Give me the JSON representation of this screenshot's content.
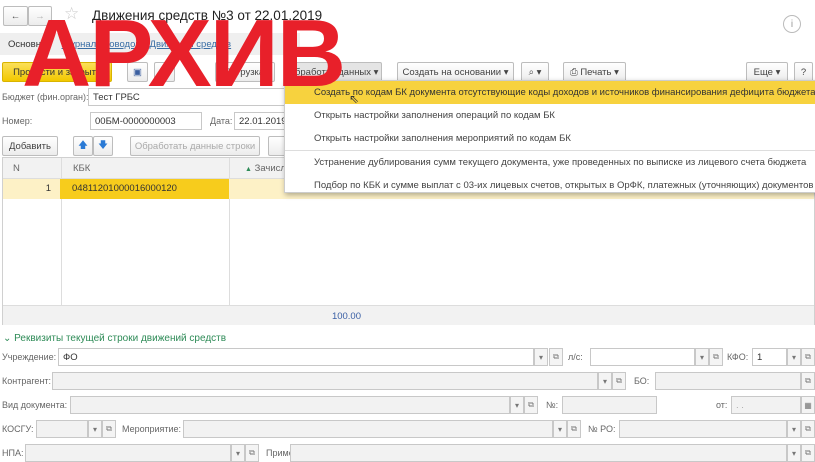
{
  "window": {
    "title": "Движения средств №3 от 22.01.2019",
    "watermark": "АРХИВ"
  },
  "tabs": [
    {
      "label": "Основное"
    },
    {
      "label": "Журнал проводок"
    },
    {
      "label": "Движения средств"
    }
  ],
  "toolbar": {
    "post_close": "Провести и закрыть",
    "load": "Загрузка",
    "process_data": "Обработка данных",
    "create_based": "Создать на основании",
    "print": "Печать",
    "more": "Еще",
    "help": "?"
  },
  "dropdown": {
    "items": [
      "Создать по кодам БК документа отсутствующие коды доходов и источников финансирования дефицита бюджета",
      "Открыть настройки заполнения операций по кодам БК",
      "Открыть настройки заполнения мероприятий по кодам БК",
      "Устранение дублирования сумм текущего документа, уже проведенных по выписке из лицевого счета бюджета",
      "Подбор по КБК и сумме выплат с 03-их лицевых счетов, открытых в ОрФК, платежных (уточняющих) документов учре"
    ]
  },
  "header": {
    "budget_label": "Бюджет (фин.орган):",
    "budget_value": "Тест ГРБС",
    "number_label": "Номер:",
    "number_value": "00БМ-0000000003",
    "date_label": "Дата:",
    "date_value": "22.01.2019"
  },
  "table_toolbar": {
    "add": "Добавить",
    "process_rows": "Обработать данные строки"
  },
  "table": {
    "columns": [
      "N",
      "КБК",
      "Зачисл"
    ],
    "rows": [
      {
        "n": "1",
        "kbk": "04811201000016000120"
      }
    ],
    "total": "100.00"
  },
  "details": {
    "section_title": "Реквизиты текущей строки движений средств",
    "institution_label": "Учреждение:",
    "institution_value": "ФО",
    "ls_label": "л/с:",
    "kfo_label": "КФО:",
    "kfo_value": "1",
    "counterparty_label": "Контрагент:",
    "bo_label": "БО:",
    "doc_type_label": "Вид документа:",
    "num_label": "№:",
    "from_label": "от:",
    "from_value": ". .",
    "kosgu_label": "КОСГУ:",
    "event_label": "Мероприятие:",
    "ro_label": "№ РО:",
    "npa_label": "НПА:",
    "note_label": "Примечание:"
  }
}
